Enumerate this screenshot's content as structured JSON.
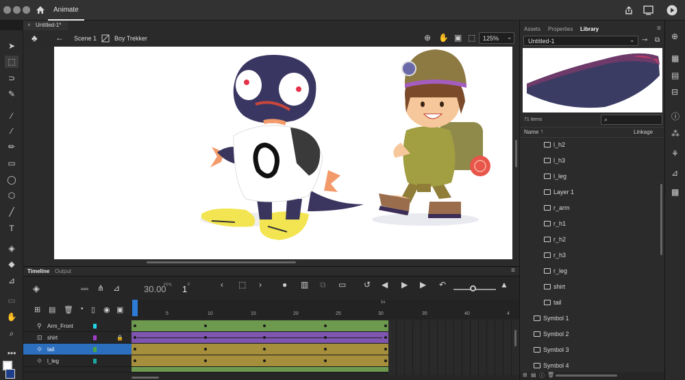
{
  "app": {
    "name": "Animate"
  },
  "document": {
    "tab_title": "Untitled-1*",
    "scene": "Scene 1",
    "symbol": "Boy Trekker",
    "zoom": "125%"
  },
  "right_panel": {
    "tabs": [
      "Assets",
      "Properties",
      "Library"
    ],
    "active_tab": "Library",
    "library_name": "Untitled-1",
    "item_count": "71 items",
    "search_placeholder": "",
    "col_name": "Name",
    "col_linkage": "Linkage",
    "items": [
      {
        "label": "l_h2",
        "kind": "bitmap"
      },
      {
        "label": "l_h3",
        "kind": "bitmap"
      },
      {
        "label": "l_leg",
        "kind": "bitmap"
      },
      {
        "label": "Layer 1",
        "kind": "bitmap"
      },
      {
        "label": "r_arm",
        "kind": "bitmap"
      },
      {
        "label": "r_h1",
        "kind": "bitmap"
      },
      {
        "label": "r_h2",
        "kind": "bitmap"
      },
      {
        "label": "r_h3",
        "kind": "bitmap"
      },
      {
        "label": "r_leg",
        "kind": "bitmap"
      },
      {
        "label": "shirt",
        "kind": "bitmap"
      },
      {
        "label": "tail",
        "kind": "bitmap"
      },
      {
        "label": "Symbol 1",
        "kind": "symbol"
      },
      {
        "label": "Symbol 2",
        "kind": "symbol"
      },
      {
        "label": "Symbol 3",
        "kind": "symbol"
      },
      {
        "label": "Symbol 4",
        "kind": "symbol"
      }
    ]
  },
  "timeline": {
    "tabs": [
      "Timeline",
      "Output"
    ],
    "fps": "30.00",
    "fps_unit": "FPS",
    "frame": "1",
    "frame_unit": "F",
    "seconds_marker": "1s",
    "ruler": [
      "5",
      "10",
      "15",
      "20",
      "25",
      "30",
      "35",
      "40",
      "4"
    ],
    "layers": [
      {
        "name": "Arm_Front",
        "color": "#22d3e6",
        "frame_color": "#6e9a50",
        "selected": false,
        "locked": false
      },
      {
        "name": "shirt",
        "color": "#a13ec9",
        "frame_color": "#7e56b0",
        "selected": false,
        "locked": true
      },
      {
        "name": "tail",
        "color": "#49a640",
        "frame_color": "#a68f3c",
        "selected": true,
        "locked": false
      },
      {
        "name": "l_leg",
        "color": "#1aa8a0",
        "frame_color": "#a68f3c",
        "selected": false,
        "locked": false
      }
    ]
  },
  "colors": {
    "accent": "#2d7bd6",
    "panel": "#2b2b2b",
    "stage": "#ffffff"
  }
}
